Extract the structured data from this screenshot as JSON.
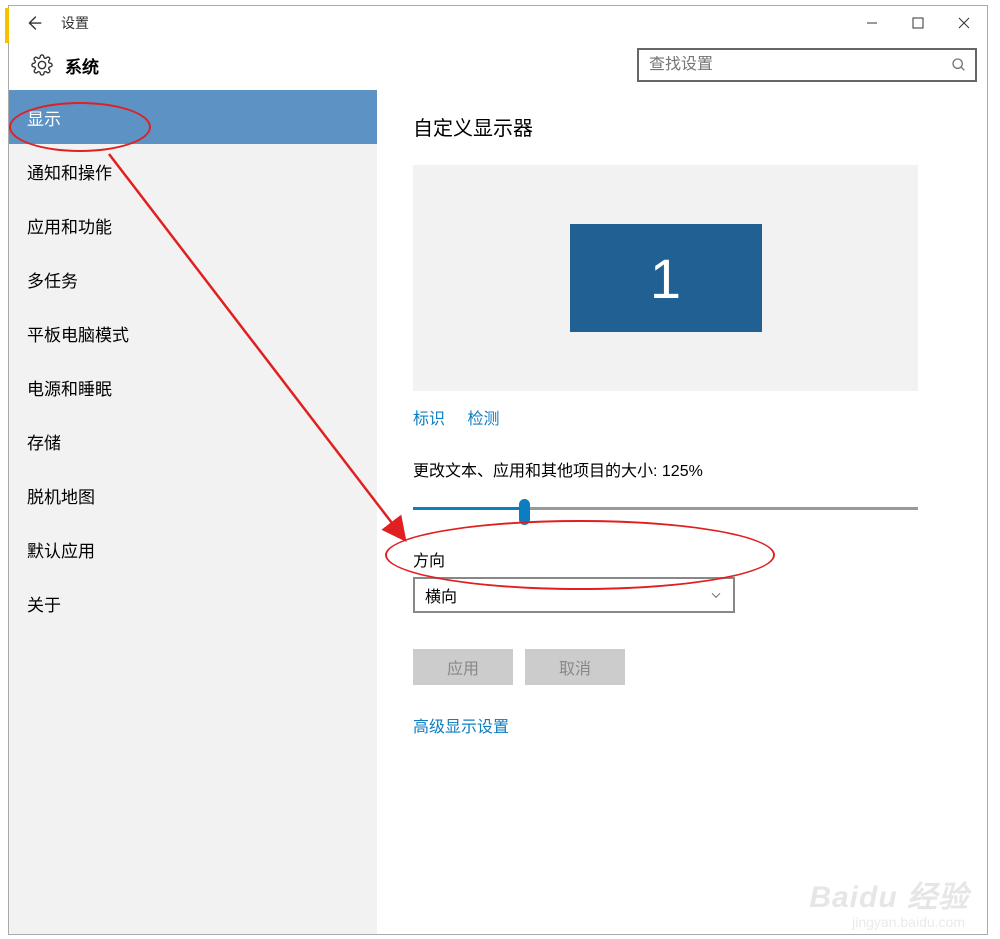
{
  "window": {
    "title": "设置"
  },
  "header": {
    "title": "系统",
    "search_placeholder": "查找设置"
  },
  "sidebar": {
    "items": [
      {
        "label": "显示"
      },
      {
        "label": "通知和操作"
      },
      {
        "label": "应用和功能"
      },
      {
        "label": "多任务"
      },
      {
        "label": "平板电脑模式"
      },
      {
        "label": "电源和睡眠"
      },
      {
        "label": "存储"
      },
      {
        "label": "脱机地图"
      },
      {
        "label": "默认应用"
      },
      {
        "label": "关于"
      }
    ]
  },
  "main": {
    "title": "自定义显示器",
    "monitor_number": "1",
    "identify_link": "标识",
    "detect_link": "检测",
    "scale_label": "更改文本、应用和其他项目的大小: 125%",
    "orientation_label": "方向",
    "orientation_value": "横向",
    "apply_btn": "应用",
    "cancel_btn": "取消",
    "advanced_link": "高级显示设置"
  },
  "watermark": {
    "brand": "Baidu 经验",
    "url": "jingyan.baidu.com"
  }
}
